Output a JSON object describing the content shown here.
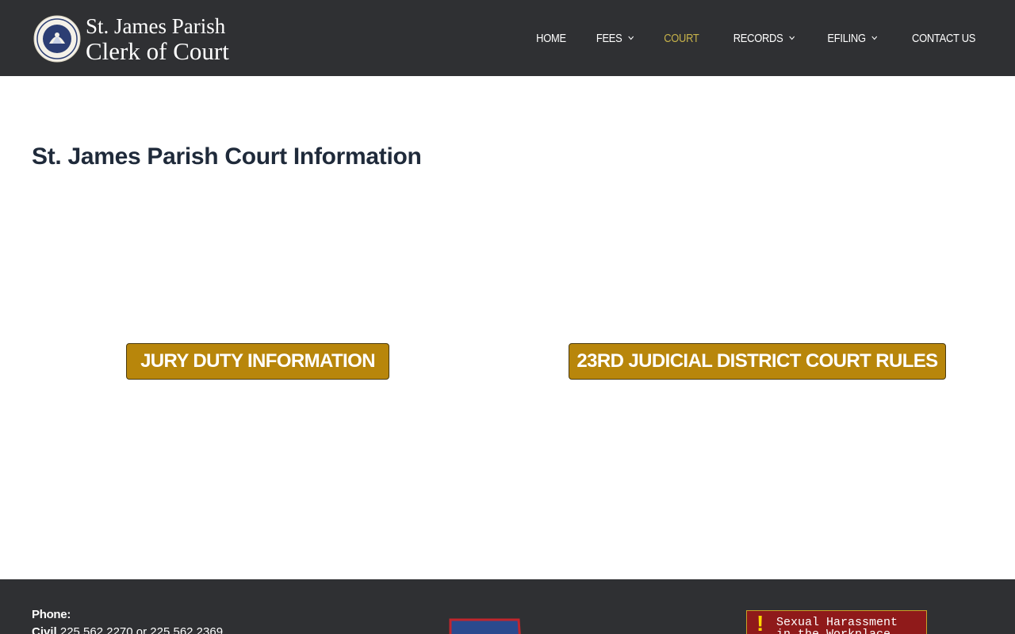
{
  "header": {
    "brand": {
      "line1": "St. James Parish",
      "line2": "Clerk of Court"
    },
    "nav": [
      {
        "label": "HOME",
        "has_dropdown": false,
        "active": false
      },
      {
        "label": "FEES",
        "has_dropdown": true,
        "active": false
      },
      {
        "label": "COURT",
        "has_dropdown": false,
        "active": true
      },
      {
        "label": "RECORDS",
        "has_dropdown": true,
        "active": false
      },
      {
        "label": "EFILING",
        "has_dropdown": true,
        "active": false
      },
      {
        "label": "CONTACT US",
        "has_dropdown": false,
        "active": false
      }
    ]
  },
  "main": {
    "title": "St. James Parish Court Information",
    "buttons": {
      "jury": "JURY DUTY INFORMATION",
      "rules": "23RD JUDICIAL DISTRICT COURT RULES"
    }
  },
  "footer": {
    "phone_label": "Phone:",
    "civil_label": "Civil",
    "civil_numbers": " 225.562.2270 or 225.562.2369",
    "badge_text": "Sexual Harassment\nin the Workplace"
  },
  "colors": {
    "header_bg": "#2f3033",
    "nav_active": "#c6b24a",
    "cta_bg": "#b8860b",
    "title_color": "#1f2a3a",
    "badge_bg": "#8f1a1a"
  },
  "icons": {
    "seal": "parish-seal-icon",
    "dropdown": "chevron-down-icon",
    "map": "louisiana-map-icon",
    "alert": "exclamation-icon"
  }
}
